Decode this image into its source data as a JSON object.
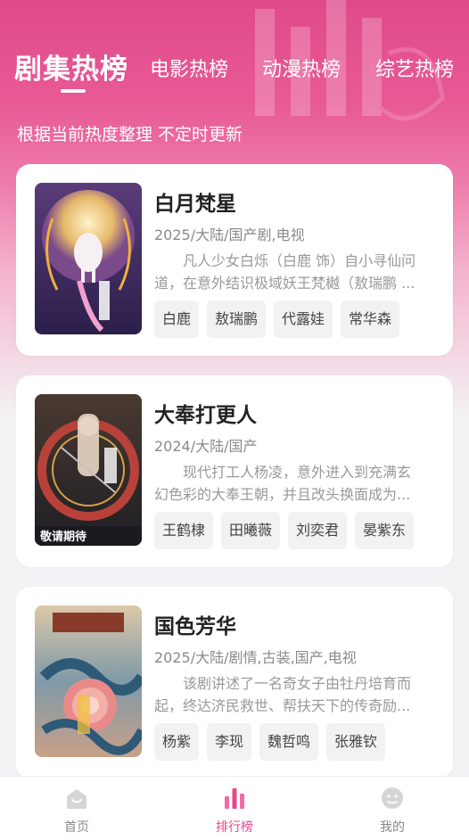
{
  "tabs": [
    {
      "label": "剧集热榜",
      "active": true
    },
    {
      "label": "电影热榜",
      "active": false
    },
    {
      "label": "动漫热榜",
      "active": false
    },
    {
      "label": "综艺热榜",
      "active": false
    }
  ],
  "subtitle": "根据当前热度整理 不定时更新",
  "cards": [
    {
      "title": "白月梵星",
      "meta": "2025/大陆/国产剧,电视",
      "desc_line1": "凡人少女白烁（白鹿 饰）自小寻仙问",
      "desc_line2": "道，在意外结识极域妖王梵樾（敖瑞鹏 ...",
      "tags": [
        "白鹿",
        "敖瑞鹏",
        "代露娃",
        "常华森"
      ]
    },
    {
      "title": "大奉打更人",
      "meta": "2024/大陆/国产",
      "desc_line1": "现代打工人杨凌，意外进入到充满玄",
      "desc_line2": "幻色彩的大奉王朝，并且改头换面成为...",
      "tags": [
        "王鹤棣",
        "田曦薇",
        "刘奕君",
        "晏紫东"
      ],
      "poster_text": "敬请期待"
    },
    {
      "title": "国色芳华",
      "meta": "2025/大陆/剧情,古装,国产,电视",
      "desc_line1": "该剧讲述了一名奇女子由牡丹培育而",
      "desc_line2": "起，终达济民救世、帮扶天下的传奇励...",
      "tags": [
        "杨紫",
        "李现",
        "魏哲鸣",
        "张雅钦"
      ]
    }
  ],
  "bottom_nav": [
    {
      "label": "首页",
      "icon": "home-icon",
      "active": false
    },
    {
      "label": "排行榜",
      "icon": "chart-icon",
      "active": true
    },
    {
      "label": "我的",
      "icon": "profile-icon",
      "active": false
    }
  ],
  "colors": {
    "accent": "#e8468a",
    "header_top": "#e04a8a",
    "card_bg": "#ffffff",
    "tag_bg": "#f2f2f2"
  }
}
